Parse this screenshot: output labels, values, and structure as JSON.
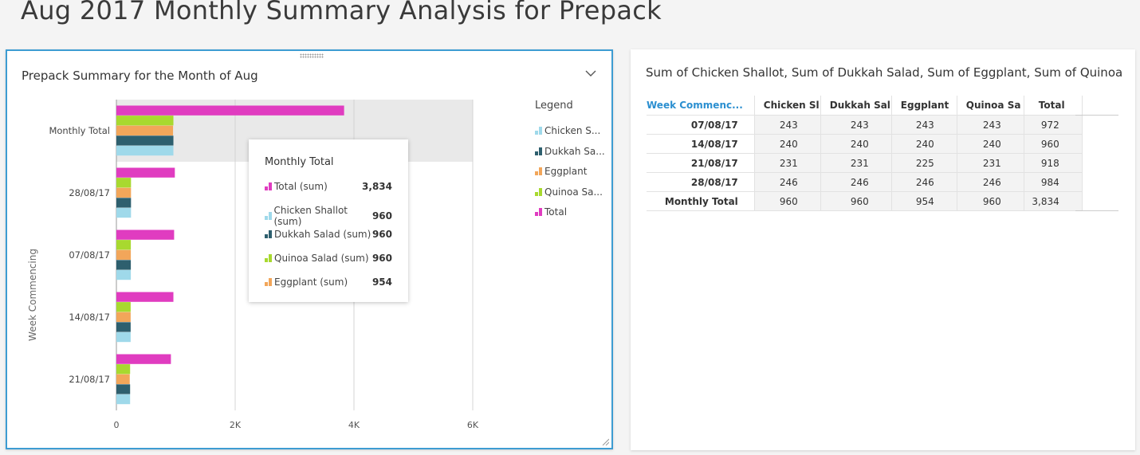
{
  "page": {
    "title": "Aug 2017 Monthly Summary Analysis for Prepack"
  },
  "left_panel": {
    "title": "Prepack Summary for the Month of Aug",
    "legend_title": "Legend",
    "legend": [
      {
        "label": "Chicken S...",
        "color": "#9fd9ea"
      },
      {
        "label": "Dukkah Sa...",
        "color": "#2e5f6e"
      },
      {
        "label": "Eggplant",
        "color": "#f2a65a"
      },
      {
        "label": "Quinoa Sa...",
        "color": "#a8d92f"
      },
      {
        "label": "Total",
        "color": "#e03cc0"
      }
    ],
    "tooltip": {
      "title": "Monthly Total",
      "rows": [
        {
          "label": "Total (sum)",
          "value": "3,834",
          "color": "#e03cc0"
        },
        {
          "label": "Chicken Shallot (sum)",
          "value": "960",
          "color": "#9fd9ea"
        },
        {
          "label": "Dukkah Salad (sum)",
          "value": "960",
          "color": "#2e5f6e"
        },
        {
          "label": "Quinoa Salad (sum)",
          "value": "960",
          "color": "#a8d92f"
        },
        {
          "label": "Eggplant (sum)",
          "value": "954",
          "color": "#f2a65a"
        }
      ]
    }
  },
  "chart_data": {
    "type": "bar",
    "orientation": "horizontal",
    "title": "Prepack Summary for the Month of Aug",
    "ylabel": "Week Commencing",
    "xlabel": "",
    "xlim": [
      0,
      6000
    ],
    "xticks": [
      "0",
      "2K",
      "4K",
      "6K"
    ],
    "categories": [
      "Monthly Total",
      "28/08/17",
      "07/08/17",
      "14/08/17",
      "21/08/17"
    ],
    "highlighted_category": "Monthly Total",
    "series": [
      {
        "name": "Total",
        "color": "#e03cc0",
        "values": [
          3834,
          984,
          972,
          960,
          918
        ]
      },
      {
        "name": "Quinoa Sa...",
        "color": "#a8d92f",
        "values": [
          960,
          246,
          243,
          240,
          231
        ]
      },
      {
        "name": "Eggplant",
        "color": "#f2a65a",
        "values": [
          954,
          246,
          243,
          240,
          225
        ]
      },
      {
        "name": "Dukkah Sa...",
        "color": "#2e5f6e",
        "values": [
          960,
          246,
          243,
          240,
          231
        ]
      },
      {
        "name": "Chicken S...",
        "color": "#9fd9ea",
        "values": [
          960,
          246,
          243,
          240,
          231
        ]
      }
    ],
    "grid": true,
    "legend_position": "right"
  },
  "right_panel": {
    "title": "Sum of Chicken Shallot, Sum of Dukkah Salad, Sum of Eggplant, Sum of Quinoa Sa...",
    "table": {
      "headers": [
        "Week Commenc...",
        "Chicken Sl",
        "Dukkah Sal",
        "Eggplant",
        "Quinoa Sa",
        "Total"
      ],
      "rows": [
        [
          "07/08/17",
          "243",
          "243",
          "243",
          "243",
          "972"
        ],
        [
          "14/08/17",
          "240",
          "240",
          "240",
          "240",
          "960"
        ],
        [
          "21/08/17",
          "231",
          "231",
          "225",
          "231",
          "918"
        ],
        [
          "28/08/17",
          "246",
          "246",
          "246",
          "246",
          "984"
        ],
        [
          "Monthly Total",
          "960",
          "960",
          "954",
          "960",
          "3,834"
        ]
      ]
    }
  }
}
